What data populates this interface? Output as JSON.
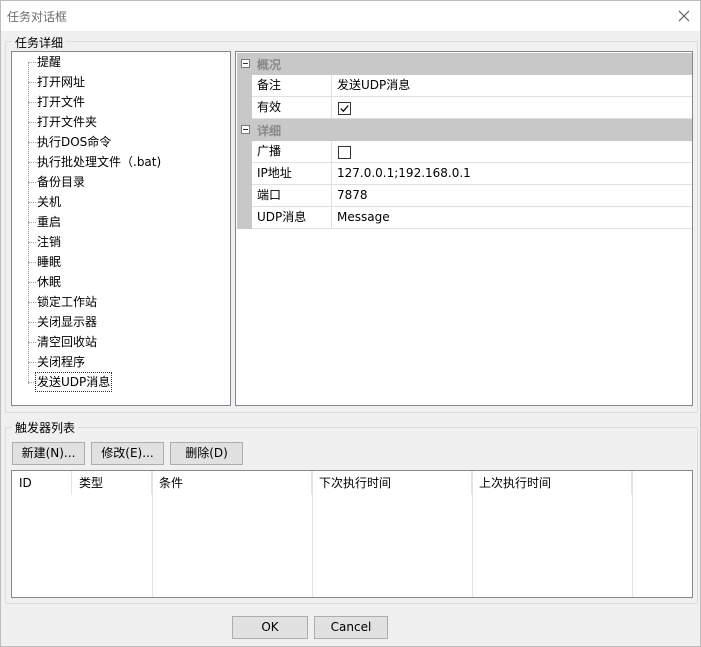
{
  "window": {
    "title": "任务对话框"
  },
  "task_details": {
    "legend": "任务详细",
    "tree_items": [
      "提醒",
      "打开网址",
      "打开文件",
      "打开文件夹",
      "执行DOS命令",
      "执行批处理文件（.bat)",
      "备份目录",
      "关机",
      "重启",
      "注销",
      "睡眠",
      "休眠",
      "锁定工作站",
      "关闭显示器",
      "清空回收站",
      "关闭程序",
      "发送UDP消息"
    ],
    "selected_item": "发送UDP消息"
  },
  "properties": {
    "overview": {
      "label": "概况",
      "rows": [
        {
          "name": "备注",
          "value": "发送UDP消息"
        },
        {
          "name": "有效",
          "checked": true
        }
      ]
    },
    "details": {
      "label": "详细",
      "rows": [
        {
          "name": "广播",
          "checked": false
        },
        {
          "name": "IP地址",
          "value": "127.0.0.1;192.168.0.1"
        },
        {
          "name": "端口",
          "value": "7878"
        },
        {
          "name": "UDP消息",
          "value": "Message"
        }
      ]
    }
  },
  "triggers": {
    "legend": "触发器列表",
    "new_label": "新建(N)...",
    "edit_label": "修改(E)...",
    "delete_label": "删除(D)",
    "columns": [
      "ID",
      "类型",
      "条件",
      "下次执行时间",
      "上次执行时间"
    ]
  },
  "footer": {
    "ok_label": "OK",
    "cancel_label": "Cancel"
  }
}
